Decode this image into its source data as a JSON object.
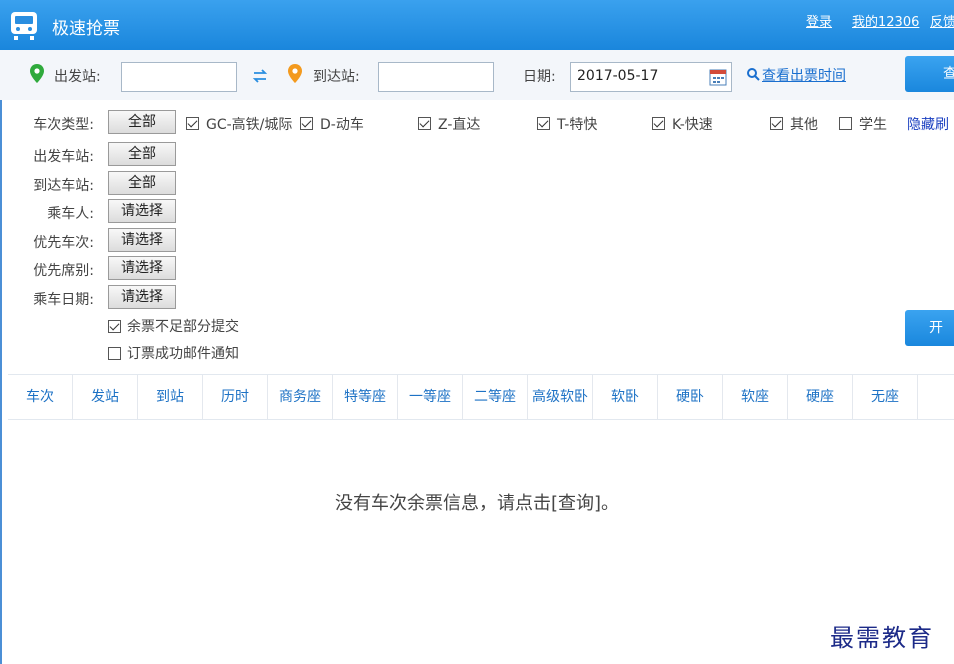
{
  "app": {
    "title": "极速抢票"
  },
  "header_links": {
    "login": "登录",
    "my12306": "我的12306",
    "feedback": "反馈"
  },
  "search": {
    "from_label": "出发站:",
    "from_value": "",
    "to_label": "到达站:",
    "to_value": "",
    "date_label": "日期:",
    "date_value": "2017-05-17",
    "check_time_link": "查看出票时间",
    "query_button": "查询",
    "swap_icon": "swap-arrows-icon",
    "location_icon": "map-pin-icon",
    "calendar_icon": "calendar-icon",
    "search_icon": "magnifier-icon"
  },
  "filters": {
    "train_type_label": "车次类型:",
    "train_type_button": "全部",
    "train_types": [
      {
        "label": "GC-高铁/城际",
        "checked": true
      },
      {
        "label": "D-动车",
        "checked": true
      },
      {
        "label": "Z-直达",
        "checked": true
      },
      {
        "label": "T-特快",
        "checked": true
      },
      {
        "label": "K-快速",
        "checked": true
      },
      {
        "label": "其他",
        "checked": true
      },
      {
        "label": "学生",
        "checked": false
      }
    ],
    "hide_link": "隐藏刷",
    "rows": [
      {
        "label": "出发车站:",
        "button": "全部"
      },
      {
        "label": "到达车站:",
        "button": "全部"
      },
      {
        "label": "乘车人:",
        "button": "请选择"
      },
      {
        "label": "优先车次:",
        "button": "请选择"
      },
      {
        "label": "优先席别:",
        "button": "请选择"
      },
      {
        "label": "乘车日期:",
        "button": "请选择"
      }
    ],
    "partial_submit": {
      "label": "余票不足部分提交",
      "checked": true
    },
    "email_notify": {
      "label": "订票成功邮件通知",
      "checked": false
    },
    "start_button": "开始"
  },
  "table": {
    "columns": [
      "车次",
      "发站",
      "到站",
      "历时",
      "商务座",
      "特等座",
      "一等座",
      "二等座",
      "高级软卧",
      "软卧",
      "硬卧",
      "软座",
      "硬座",
      "无座"
    ],
    "empty_message": "没有车次余票信息，请点击[查询]。"
  },
  "watermark": "最需教育",
  "colors": {
    "accent": "#1a86dc",
    "header_text": "#1d72c5",
    "pin_green": "#2faa3c",
    "pin_orange": "#f39a1e"
  }
}
